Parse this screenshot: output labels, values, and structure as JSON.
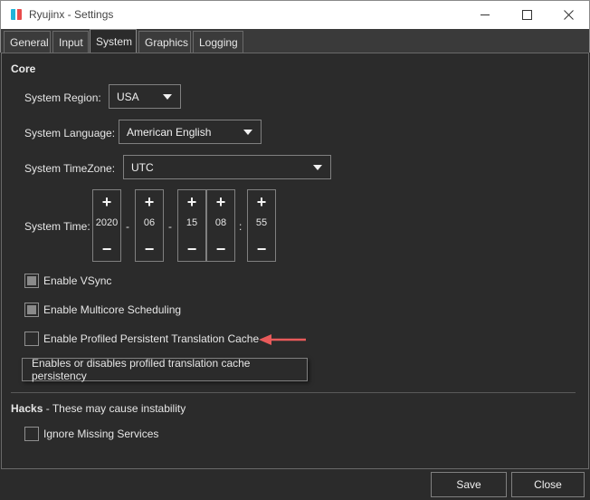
{
  "window": {
    "title": "Ryujinx - Settings"
  },
  "tabs": [
    {
      "label": "General"
    },
    {
      "label": "Input"
    },
    {
      "label": "System"
    },
    {
      "label": "Graphics"
    },
    {
      "label": "Logging"
    }
  ],
  "active_tab": "System",
  "core": {
    "title": "Core",
    "region_label": "System Region:",
    "region_value": "USA",
    "language_label": "System Language:",
    "language_value": "American English",
    "timezone_label": "System TimeZone:",
    "timezone_value": "UTC",
    "time_label": "System Time:",
    "time": {
      "year": "2020",
      "month": "06",
      "day": "15",
      "hour": "08",
      "minute": "55"
    },
    "date_sep": "-",
    "time_sep": ":",
    "plus": "+",
    "minus": "−"
  },
  "options": {
    "vsync": {
      "label": "Enable VSync",
      "checked": true
    },
    "multicore": {
      "label": "Enable Multicore Scheduling",
      "checked": true
    },
    "ptc": {
      "label": "Enable Profiled Persistent Translation Cache",
      "checked": false
    },
    "ptc_tooltip": "Enables or disables profiled translation cache persistency"
  },
  "hacks": {
    "title": "Hacks",
    "subtitle": " - These may cause instability",
    "ignore_missing": {
      "label": "Ignore Missing Services",
      "checked": false
    }
  },
  "buttons": {
    "save": "Save",
    "close": "Close"
  },
  "colors": {
    "annotation_arrow": "#e85a5a",
    "background": "#2b2b2b"
  },
  "icons": {
    "app": "ryujinx-logo-icon",
    "minimize": "minimize-icon",
    "maximize": "maximize-icon",
    "close": "close-icon"
  }
}
